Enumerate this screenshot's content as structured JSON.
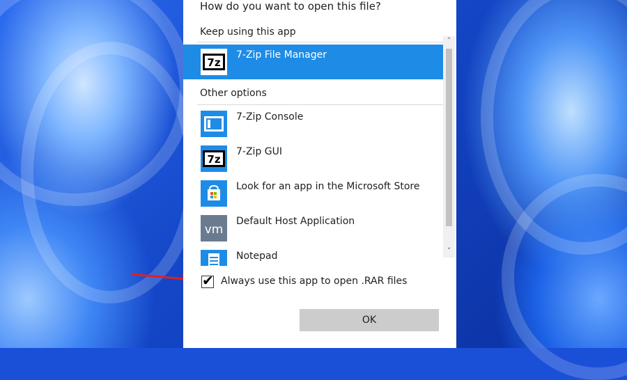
{
  "dialog": {
    "title": "How do you want to open this file?",
    "keep_label": "Keep using this app",
    "other_label": "Other options",
    "current_app": {
      "label": "7-Zip File Manager",
      "icon": "7zip-icon"
    },
    "options": [
      {
        "label": "7-Zip Console",
        "icon": "console-icon"
      },
      {
        "label": "7-Zip GUI",
        "icon": "7zip-icon"
      },
      {
        "label": "Look for an app in the Microsoft Store",
        "icon": "store-icon"
      },
      {
        "label": "Default Host Application",
        "icon": "vm-icon"
      },
      {
        "label": "Notepad",
        "icon": "notepad-icon"
      }
    ],
    "always_use_label": "Always use this app to open .RAR files",
    "always_use_checked": true,
    "ok_label": "OK"
  },
  "colors": {
    "selection": "#1e8ce6",
    "icon_blue": "#1e8ce6",
    "annotation_arrow": "#e02020",
    "button": "#cccccc"
  }
}
